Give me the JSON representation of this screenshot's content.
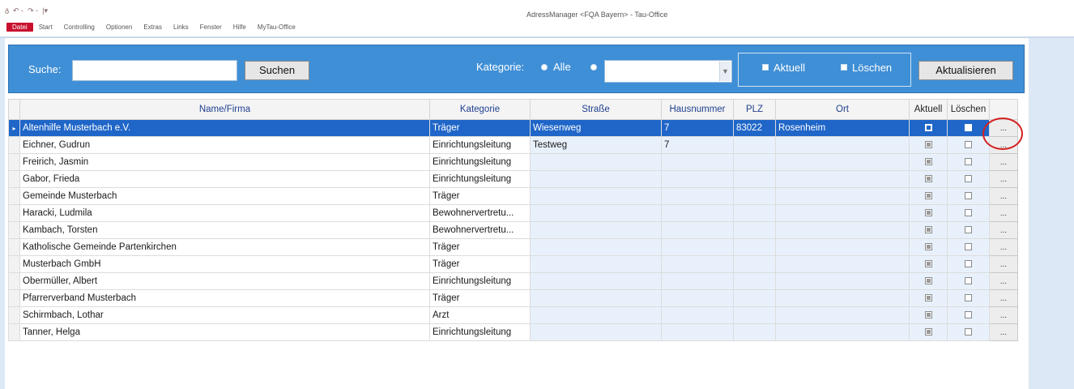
{
  "window": {
    "title": "AdressManager <FQA Bayern> - Tau-Office",
    "quick_access": [
      "ð",
      "↶ -",
      "↷ -",
      "|▾"
    ]
  },
  "menu": {
    "items": [
      "Datei",
      "Start",
      "Controlling",
      "Optionen",
      "Extras",
      "Links",
      "Fenster",
      "Hilfe",
      "MyTau-Office"
    ],
    "active": "Datei"
  },
  "search": {
    "label": "Suche:",
    "value": "",
    "button": "Suchen"
  },
  "category_filter": {
    "label": "Kategorie:",
    "option_all": "Alle",
    "selected": "Alle",
    "select_value": ""
  },
  "options": {
    "aktuell_label": "Aktuell",
    "loeschen_label": "Löschen"
  },
  "refresh_button": "Aktualisieren",
  "grid": {
    "columns": [
      "Name/Firma",
      "Kategorie",
      "Straße",
      "Hausnummer",
      "PLZ",
      "Ort",
      "Aktuell",
      "Löschen"
    ],
    "rows": [
      {
        "name": "Altenhilfe Musterbach e.V.",
        "kategorie": "Träger",
        "strasse": "Wiesenweg",
        "hausnummer": "7",
        "plz": "83022",
        "ort": "Rosenheim",
        "aktuell": true,
        "loeschen": false,
        "selected": true
      },
      {
        "name": "Eichner, Gudrun",
        "kategorie": "Einrichtungsleitung",
        "strasse": "Testweg",
        "hausnummer": "7",
        "plz": "",
        "ort": "",
        "aktuell": true,
        "loeschen": false
      },
      {
        "name": "Freirich, Jasmin",
        "kategorie": "Einrichtungsleitung",
        "strasse": "",
        "hausnummer": "",
        "plz": "",
        "ort": "",
        "aktuell": true,
        "loeschen": false
      },
      {
        "name": "Gabor, Frieda",
        "kategorie": "Einrichtungsleitung",
        "strasse": "",
        "hausnummer": "",
        "plz": "",
        "ort": "",
        "aktuell": true,
        "loeschen": false
      },
      {
        "name": "Gemeinde Musterbach",
        "kategorie": "Träger",
        "strasse": "",
        "hausnummer": "",
        "plz": "",
        "ort": "",
        "aktuell": true,
        "loeschen": false
      },
      {
        "name": "Haracki, Ludmila",
        "kategorie": "Bewohnervertretu...",
        "strasse": "",
        "hausnummer": "",
        "plz": "",
        "ort": "",
        "aktuell": true,
        "loeschen": false
      },
      {
        "name": "Kambach, Torsten",
        "kategorie": "Bewohnervertretu...",
        "strasse": "",
        "hausnummer": "",
        "plz": "",
        "ort": "",
        "aktuell": true,
        "loeschen": false
      },
      {
        "name": "Katholische Gemeinde Partenkirchen",
        "kategorie": "Träger",
        "strasse": "",
        "hausnummer": "",
        "plz": "",
        "ort": "",
        "aktuell": true,
        "loeschen": false
      },
      {
        "name": "Musterbach GmbH",
        "kategorie": "Träger",
        "strasse": "",
        "hausnummer": "",
        "plz": "",
        "ort": "",
        "aktuell": true,
        "loeschen": false
      },
      {
        "name": "Obermüller, Albert",
        "kategorie": "Einrichtungsleitung",
        "strasse": "",
        "hausnummer": "",
        "plz": "",
        "ort": "",
        "aktuell": true,
        "loeschen": false
      },
      {
        "name": "Pfarrerverband Musterbach",
        "kategorie": "Träger",
        "strasse": "",
        "hausnummer": "",
        "plz": "",
        "ort": "",
        "aktuell": true,
        "loeschen": false
      },
      {
        "name": "Schirmbach, Lothar",
        "kategorie": "Arzt",
        "strasse": "",
        "hausnummer": "",
        "plz": "",
        "ort": "",
        "aktuell": true,
        "loeschen": false
      },
      {
        "name": "Tanner, Helga",
        "kategorie": "Einrichtungsleitung",
        "strasse": "",
        "hausnummer": "",
        "plz": "",
        "ort": "",
        "aktuell": true,
        "loeschen": false
      }
    ],
    "row_selector_glyph": "▸",
    "row_button_label": "..."
  },
  "colors": {
    "panel_blue": "#3f8fd6",
    "selection_blue": "#1f66c8",
    "header_text": "#1f3f8f",
    "annotation_red": "#d42020",
    "active_menu": "#c8102e"
  }
}
